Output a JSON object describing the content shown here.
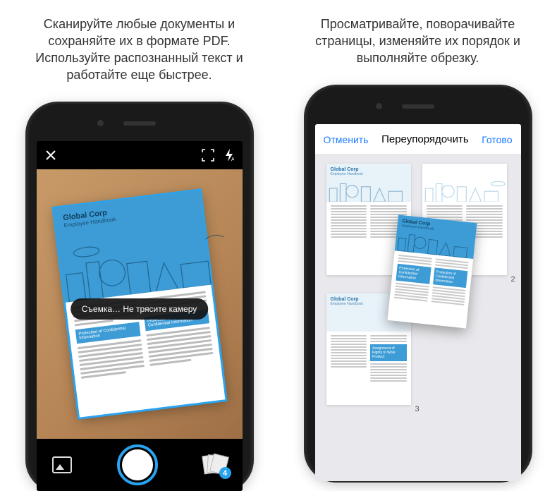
{
  "left": {
    "caption": "Сканируйте любые документы и сохраняйте их в формате PDF. Используйте распознанный текст и работайте еще быстрее.",
    "toast": "Съемка… Не трясите камеру",
    "doc_title": "Global Corp",
    "doc_subtitle": "Employee Handbook",
    "block1": "Protection of Confidential Information",
    "block2_a": "Protection of",
    "block2_b": "Confidential Information",
    "badge_count": "4"
  },
  "right": {
    "caption": "Просматривайте, поворачивайте страницы, изменяйте их порядок и выполняйте обрезку.",
    "nav_cancel": "Отменить",
    "nav_title": "Переупорядочить",
    "nav_done": "Готово",
    "doc_title": "Global Corp",
    "doc_subtitle": "Employee Handbook",
    "block_protection": "Protection of Confidential Information",
    "block_assignment": "Assignment of Rights to Work Product",
    "page2": "2",
    "page3": "3"
  }
}
